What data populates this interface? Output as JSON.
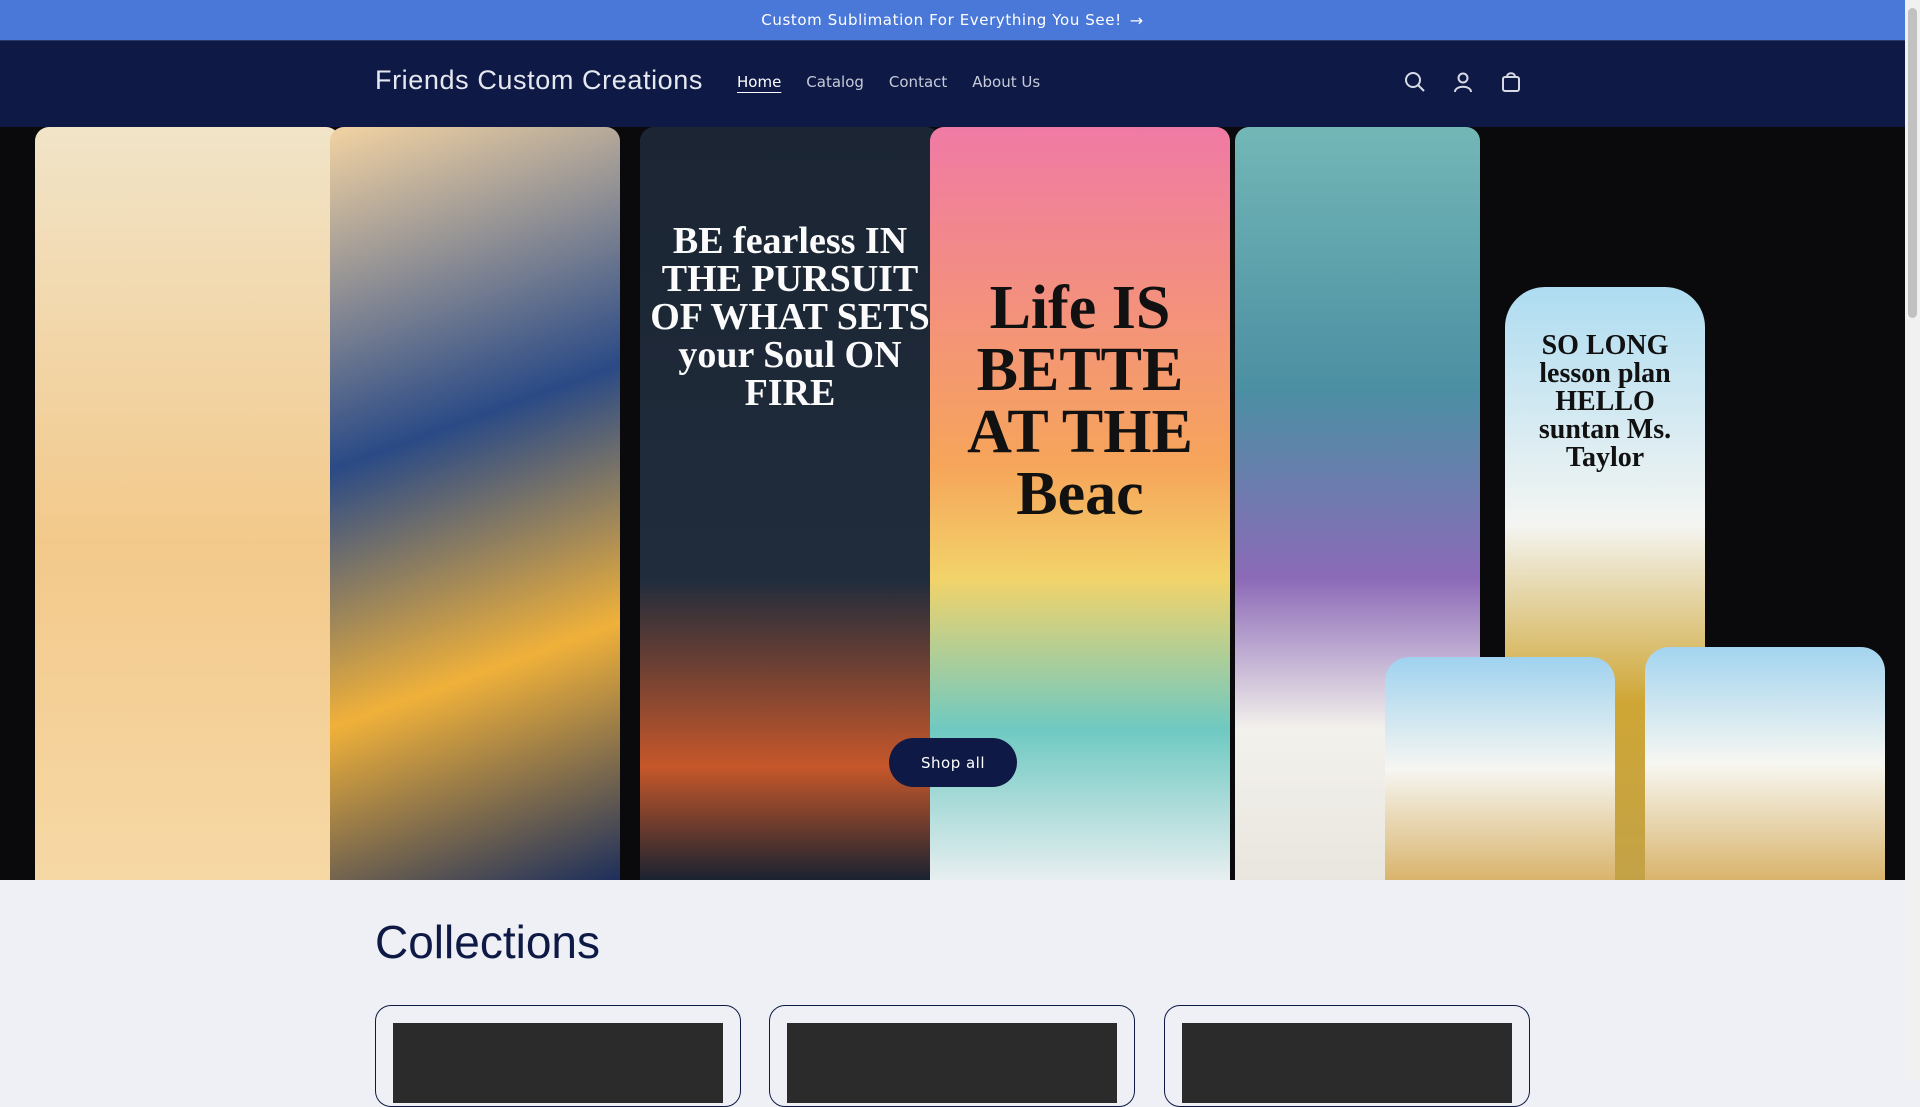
{
  "announcement": {
    "text": "Custom Sublimation For Everything You See!",
    "arrow": "→"
  },
  "header": {
    "logo": "Friends Custom Creations",
    "nav": [
      "Home",
      "Catalog",
      "Contact",
      "About Us"
    ],
    "active_nav": "Home",
    "icons": [
      "search-icon",
      "account-icon",
      "cart-icon"
    ]
  },
  "hero": {
    "button": "Shop all",
    "tumbler_texts": [
      "BE fearless IN THE PURSUIT OF WHAT SETS your Soul ON FIRE",
      "Life IS BETTE AT THE Beac",
      "SO LONG lesson plan HELLO suntan Ms. Taylor"
    ]
  },
  "collections": {
    "title": "Collections",
    "cards": [
      "card-1",
      "card-2",
      "card-3"
    ]
  },
  "colors": {
    "announce_bg": "#4a78d8",
    "header_bg": "#0e1a45",
    "page_bg": "#eef0f5"
  }
}
